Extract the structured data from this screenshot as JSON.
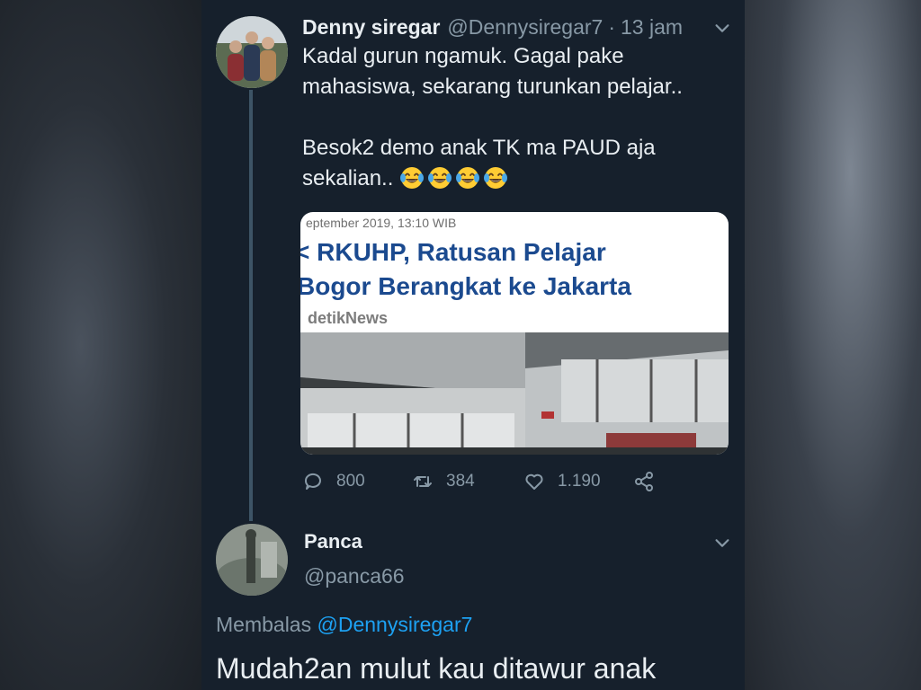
{
  "tweet": {
    "author_name": "Denny siregar",
    "handle": "@Dennysiregar7",
    "separator": "·",
    "time": "13 jam",
    "text_line_1": "Kadal gurun ngamuk. Gagal pake",
    "text_line_2": "mahasiswa, sekarang turunkan pelajar..",
    "text_line_3": "Besok2 demo anak TK ma PAUD aja",
    "text_line_4": "sekalian..",
    "emoji_icon": "face-with-tears-of-joy-icon",
    "emoji_count": 4,
    "card": {
      "date": "eptember 2019, 13:10 WIB",
      "title_line_1": "< RKUHP, Ratusan Pelajar",
      "title_line_2": "Bogor Berangkat ke Jakarta",
      "source": "detikNews"
    },
    "actions": {
      "reply_count": "800",
      "retweet_count": "384",
      "like_count": "1.190"
    }
  },
  "reply": {
    "author_name": "Panca",
    "handle": "@panca66",
    "replying_prefix": "Membalas",
    "replying_to": "@Dennysiregar7",
    "text": "Mudah2an mulut kau ditawur anak"
  },
  "colors": {
    "background": "#16202c",
    "link": "#1da1f2",
    "secondary_text": "#8899a6",
    "card_title": "#1b4a8f"
  }
}
